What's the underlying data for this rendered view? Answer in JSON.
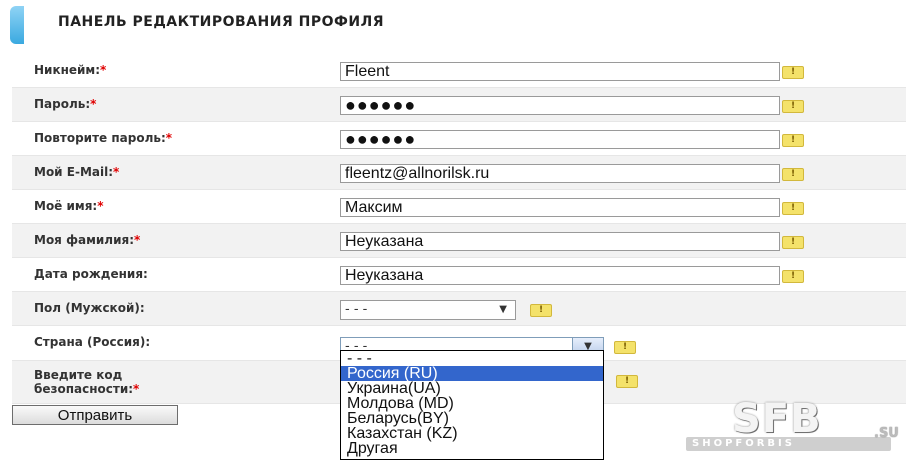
{
  "header": {
    "title": "ПАНЕЛЬ РЕДАКТИРОВАНИЯ ПРОФИЛЯ"
  },
  "fields": [
    {
      "label": "Никнейм:",
      "required": "*",
      "value": "Fleent"
    },
    {
      "label": "Пароль:",
      "required": "*",
      "value": "●●●●●●"
    },
    {
      "label": "Повторите пароль:",
      "required": "*",
      "value": "●●●●●●"
    },
    {
      "label": "Мой E-Mail:",
      "required": "*",
      "value": "fleentz@allnorilsk.ru"
    },
    {
      "label": "Моё имя:",
      "required": "*",
      "value": "Максим"
    },
    {
      "label": "Моя фамилия:",
      "required": "*",
      "value": "Неуказана"
    },
    {
      "label": "Дата рождения:",
      "required": "",
      "value": "Неуказана"
    }
  ],
  "gender": {
    "label": "Пол (Мужской):",
    "value": "- - -"
  },
  "country": {
    "label": "Страна (Россия):",
    "value": "- - -",
    "options": [
      "- - -",
      "Россия (RU)",
      "Украина(UA)",
      "Молдова (MD)",
      "Беларусь(BY)",
      "Казахстан (KZ)",
      "Другая"
    ],
    "highlighted_option": "Россия (RU)"
  },
  "captcha": {
    "label_line1": "Введите код",
    "label_line2": "безопасности:",
    "required": "*"
  },
  "submit": {
    "label": "Отправить"
  },
  "hint_icon_text": "!",
  "watermark": {
    "text": "SFB",
    "band": "SHOPFORBIS",
    "suffix": ".SU"
  }
}
